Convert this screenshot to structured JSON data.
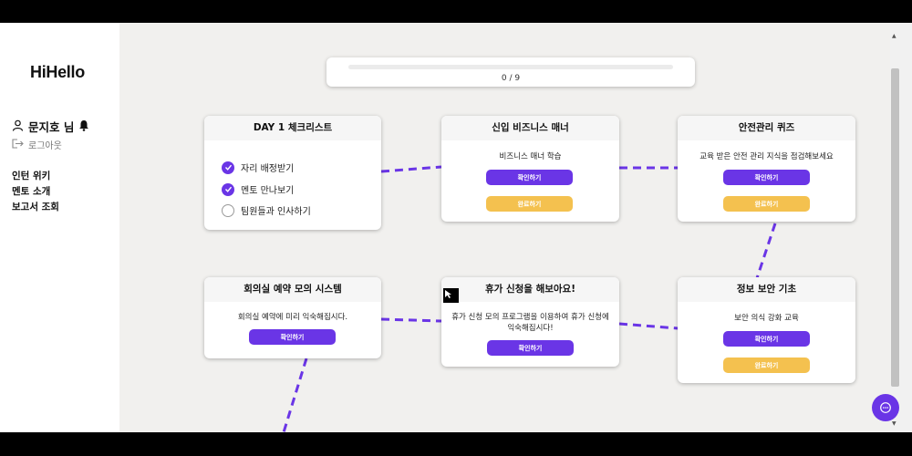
{
  "app": {
    "logo": "HiHello"
  },
  "user": {
    "name": "문지호 님",
    "logout": "로그아웃"
  },
  "nav": {
    "items": [
      "인턴 위키",
      "멘토 소개",
      "보고서 조회"
    ]
  },
  "progress": {
    "text": "0 / 9",
    "fraction": 0
  },
  "buttons": {
    "confirm": "확인하기",
    "complete": "완료하기"
  },
  "cards": {
    "day1": {
      "title": "DAY 1 체크리스트",
      "items": [
        {
          "label": "자리 배정받기",
          "checked": true
        },
        {
          "label": "멘토 만나보기",
          "checked": true
        },
        {
          "label": "팀원들과 인사하기",
          "checked": false
        }
      ]
    },
    "manner": {
      "title": "신입 비즈니스 매너",
      "desc": "비즈니스 매너 학습"
    },
    "safety": {
      "title": "안전관리 퀴즈",
      "desc": "교육 받은 안전 관리 지식을 점검해보세요"
    },
    "meeting": {
      "title": "회의실 예약 모의 시스템",
      "desc": "회의실 예약에 미리 익숙해집시다."
    },
    "vacation": {
      "title": "휴가 신청을 해보아요!",
      "desc": "휴가 신청 모의 프로그램을 이용하여 휴가 신청에 익숙해집시다!"
    },
    "security": {
      "title": "정보 보안 기초",
      "desc": "보안 의식 강화 교육"
    }
  },
  "colors": {
    "accent": "#6a35e6",
    "complete": "#f4c14f",
    "dash": "#6a35e6"
  },
  "icons": {
    "user": "user-icon",
    "bell": "bell-icon",
    "logout": "logout-icon",
    "chat": "chat-icon"
  }
}
